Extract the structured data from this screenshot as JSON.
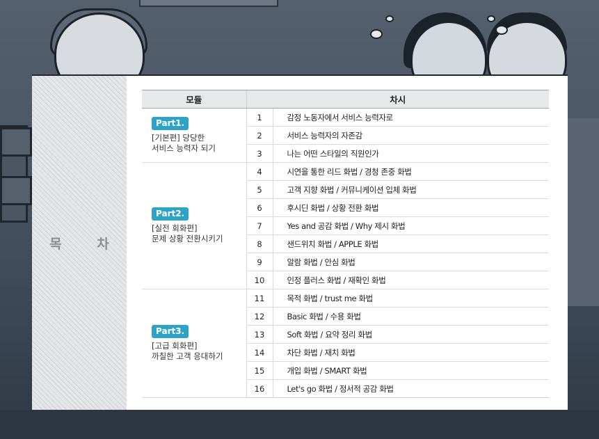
{
  "toc": {
    "title": "목  차",
    "headers": {
      "module": "모듈",
      "session": "차시"
    },
    "parts": [
      {
        "badge": "Part1.",
        "subtitle": "[기본편] 당당한",
        "name": "서비스 능력자 되기",
        "sessions": [
          {
            "no": "1",
            "title": "감정 노동자에서 서비스 능력자로"
          },
          {
            "no": "2",
            "title": "서비스 능력자의 자존감"
          },
          {
            "no": "3",
            "title": "나는 어떤 스타일의 직원인가"
          }
        ]
      },
      {
        "badge": "Part2.",
        "subtitle": "[실전 회화편]",
        "name": "문제 상황 전환시키기",
        "sessions": [
          {
            "no": "4",
            "title": "시연을 통한 리드 화법 / 경청 존중 화법"
          },
          {
            "no": "5",
            "title": "고객 지향 화법 / 커뮤니케이션 입체 화법"
          },
          {
            "no": "6",
            "title": "후시딘 화법 / 상황 전환 화법"
          },
          {
            "no": "7",
            "title": "Yes and 공감 화법 / Why 제시 화법"
          },
          {
            "no": "8",
            "title": "샌드위치 화법 / APPLE 화법"
          },
          {
            "no": "9",
            "title": "알람 화법 / 안심 화법"
          },
          {
            "no": "10",
            "title": "인정 플러스 화법 / 재확인 화법"
          }
        ]
      },
      {
        "badge": "Part3.",
        "subtitle": "[고급 회화편]",
        "name": "까칠한 고객 응대하기",
        "sessions": [
          {
            "no": "11",
            "title": "목적 화법 / trust me 화법"
          },
          {
            "no": "12",
            "title": "Basic 화법 / 수용 화법"
          },
          {
            "no": "13",
            "title": "Soft 화법 / 요약 정리 화법"
          },
          {
            "no": "14",
            "title": "차단 화법 / 재치 화법"
          },
          {
            "no": "15",
            "title": "개입 화법 / SMART 화법"
          },
          {
            "no": "16",
            "title": "Let's go 화법 / 정서적 공감 화법"
          }
        ]
      }
    ]
  }
}
